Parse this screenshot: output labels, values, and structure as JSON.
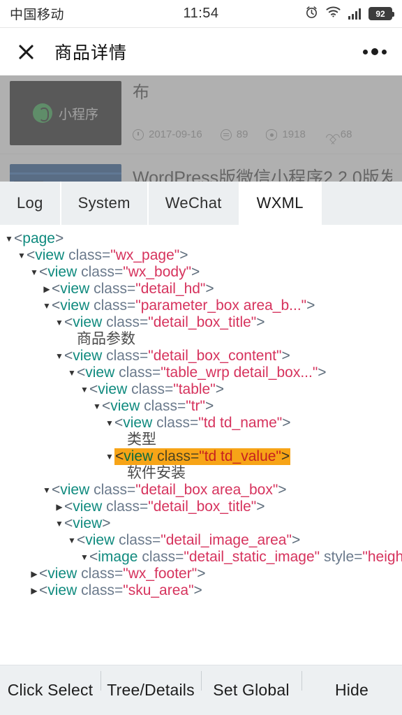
{
  "status_bar": {
    "carrier": "中国移动",
    "time": "11:54",
    "battery_level": "92",
    "icons": [
      "alarm-clock-icon",
      "wifi-icon",
      "signal-bars-icon",
      "battery-icon"
    ]
  },
  "nav_bar": {
    "close_label": "×",
    "title": "商品详情",
    "more_label": "•••"
  },
  "background_page": {
    "article1": {
      "thumb_label": "小程序",
      "title": "布",
      "date": "2017-09-16",
      "comments": "89",
      "views": "1918",
      "likes": "68"
    },
    "article2": {
      "title": "WordPress版微信小程序2.2.0版发"
    }
  },
  "debug_panel": {
    "tabs": [
      {
        "label": "Log",
        "active": false
      },
      {
        "label": "System",
        "active": false
      },
      {
        "label": "WeChat",
        "active": false
      },
      {
        "label": "WXML",
        "active": true
      }
    ],
    "tree": [
      {
        "indent": 0,
        "caret": "▼",
        "type": "tag",
        "tag": "page",
        "attr": null,
        "value": null,
        "highlight": false
      },
      {
        "indent": 1,
        "caret": "▼",
        "type": "tag",
        "tag": "view",
        "attr": "class",
        "value": "wx_page",
        "highlight": false
      },
      {
        "indent": 2,
        "caret": "▼",
        "type": "tag",
        "tag": "view",
        "attr": "class",
        "value": "wx_body",
        "highlight": false
      },
      {
        "indent": 3,
        "caret": "▶",
        "type": "tag",
        "tag": "view",
        "attr": "class",
        "value": "detail_hd",
        "highlight": false
      },
      {
        "indent": 3,
        "caret": "▼",
        "type": "tag",
        "tag": "view",
        "attr": "class",
        "value": "parameter_box area_b...",
        "highlight": false
      },
      {
        "indent": 4,
        "caret": "▼",
        "type": "tag",
        "tag": "view",
        "attr": "class",
        "value": "detail_box_title",
        "highlight": false
      },
      {
        "indent": 5,
        "caret": "",
        "type": "text",
        "text": "商品参数",
        "highlight": false
      },
      {
        "indent": 4,
        "caret": "▼",
        "type": "tag",
        "tag": "view",
        "attr": "class",
        "value": "detail_box_content",
        "highlight": false
      },
      {
        "indent": 5,
        "caret": "▼",
        "type": "tag",
        "tag": "view",
        "attr": "class",
        "value": "table_wrp detail_box...",
        "highlight": false
      },
      {
        "indent": 6,
        "caret": "▼",
        "type": "tag",
        "tag": "view",
        "attr": "class",
        "value": "table",
        "highlight": false
      },
      {
        "indent": 7,
        "caret": "▼",
        "type": "tag",
        "tag": "view",
        "attr": "class",
        "value": "tr",
        "highlight": false
      },
      {
        "indent": 8,
        "caret": "▼",
        "type": "tag",
        "tag": "view",
        "attr": "class",
        "value": "td td_name",
        "highlight": false
      },
      {
        "indent": 9,
        "caret": "",
        "type": "text",
        "text": "类型",
        "highlight": false
      },
      {
        "indent": 8,
        "caret": "▼",
        "type": "tag",
        "tag": "view",
        "attr": "class",
        "value": "td td_value",
        "highlight": true
      },
      {
        "indent": 9,
        "caret": "",
        "type": "text",
        "text": "软件安装",
        "highlight": false
      },
      {
        "indent": 3,
        "caret": "▼",
        "type": "tag",
        "tag": "view",
        "attr": "class",
        "value": "detail_box area_box",
        "highlight": false
      },
      {
        "indent": 4,
        "caret": "▶",
        "type": "tag",
        "tag": "view",
        "attr": "class",
        "value": "detail_box_title",
        "highlight": false
      },
      {
        "indent": 4,
        "caret": "▼",
        "type": "tag",
        "tag": "view",
        "attr": null,
        "value": null,
        "highlight": false
      },
      {
        "indent": 5,
        "caret": "▼",
        "type": "tag",
        "tag": "view",
        "attr": "class",
        "value": "detail_image_area",
        "highlight": false
      },
      {
        "indent": 6,
        "caret": "▼",
        "type": "image",
        "tag": "image",
        "attr": "class",
        "value": "detail_static_image",
        "attr2": "style",
        "value2": "heigh",
        "highlight": false
      },
      {
        "indent": 2,
        "caret": "▶",
        "type": "tag",
        "tag": "view",
        "attr": "class",
        "value": "wx_footer",
        "highlight": false
      },
      {
        "indent": 2,
        "caret": "▶",
        "type": "tag",
        "tag": "view",
        "attr": "class",
        "value": "sku_area",
        "highlight": false
      }
    ],
    "toolbar": [
      {
        "label": "Click Select"
      },
      {
        "label": "Tree/Details"
      },
      {
        "label": "Set Global"
      },
      {
        "label": "Hide"
      }
    ]
  },
  "colors": {
    "highlight": "#f7a417",
    "tag": "#0f8a7e",
    "value": "#d6335d",
    "tab_inactive_bg": "#eceff1",
    "toolbar_bg": "#edf0f2"
  }
}
